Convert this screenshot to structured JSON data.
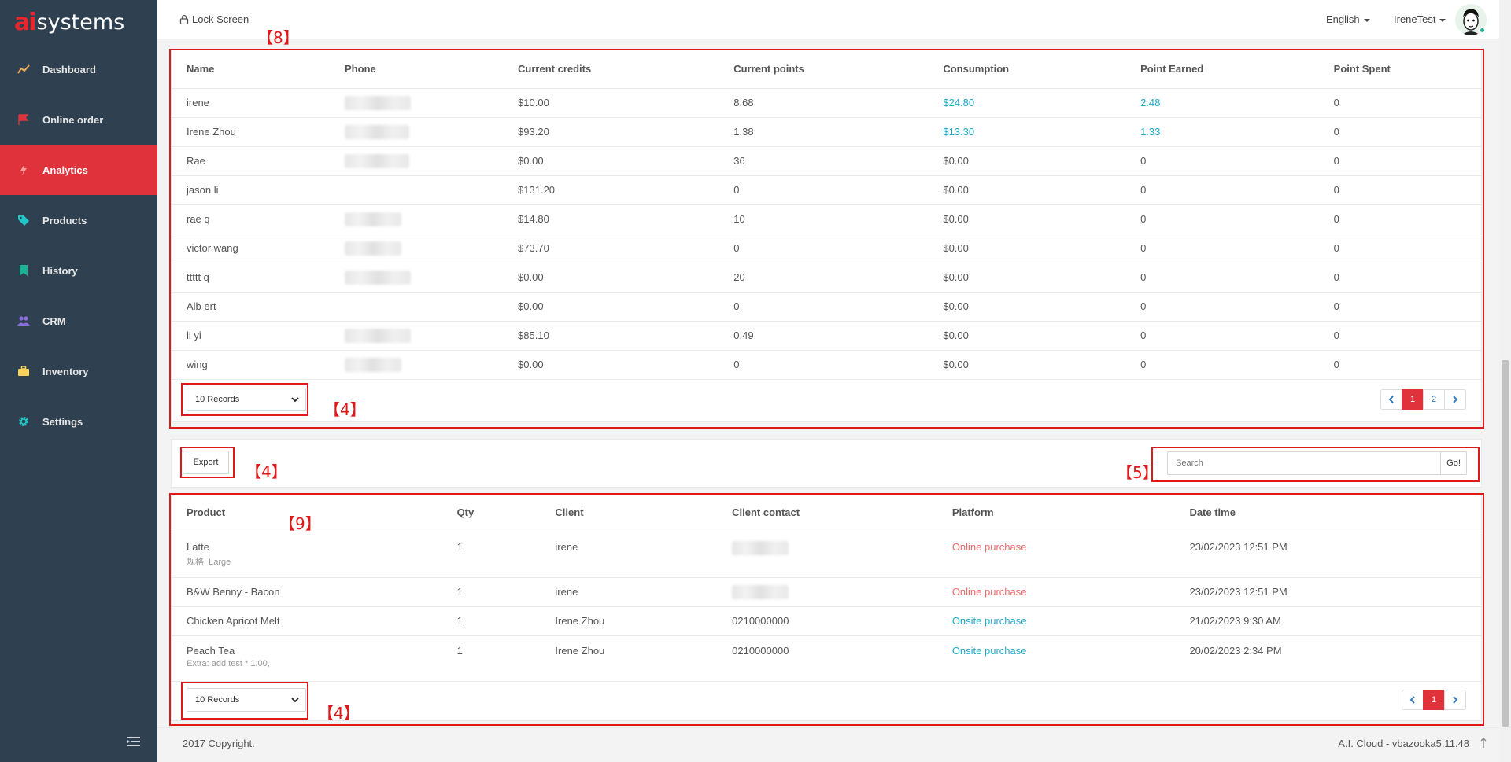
{
  "brand": {
    "logo_mark": "ai",
    "logo_text": "systems"
  },
  "sidebar": {
    "items": [
      {
        "label": "Dashboard",
        "icon": "line-chart-icon",
        "color": "#f8ac59",
        "active": false
      },
      {
        "label": "Online order",
        "icon": "flag-icon",
        "color": "#e0323a",
        "active": false
      },
      {
        "label": "Analytics",
        "icon": "bolt-icon",
        "color": "#f0a0a0",
        "active": true
      },
      {
        "label": "Products",
        "icon": "tags-icon",
        "color": "#23c6c8",
        "active": false
      },
      {
        "label": "History",
        "icon": "bookmark-icon",
        "color": "#1ab394",
        "active": false
      },
      {
        "label": "CRM",
        "icon": "users-icon",
        "color": "#8a6be0",
        "active": false
      },
      {
        "label": "Inventory",
        "icon": "briefcase-icon",
        "color": "#f8d359",
        "active": false
      },
      {
        "label": "Settings",
        "icon": "gear-icon",
        "color": "#23c6c8",
        "active": false
      }
    ]
  },
  "topbar": {
    "lock_label": "Lock Screen",
    "language": "English",
    "user": "IreneTest"
  },
  "customers": {
    "columns": [
      "Name",
      "Phone",
      "Current credits",
      "Current points",
      "Consumption",
      "Point Earned",
      "Point Spent"
    ],
    "rows": [
      {
        "name": "irene",
        "phone_blurred": true,
        "credits": "$10.00",
        "points": "8.68",
        "consumption": "$24.80",
        "earned": "2.48",
        "spent": "0",
        "highlight": true
      },
      {
        "name": "Irene Zhou",
        "phone_blurred": true,
        "credits": "$93.20",
        "points": "1.38",
        "consumption": "$13.30",
        "earned": "1.33",
        "spent": "0",
        "highlight": true
      },
      {
        "name": "Rae",
        "phone_blurred": true,
        "credits": "$0.00",
        "points": "36",
        "consumption": "$0.00",
        "earned": "0",
        "spent": "0",
        "highlight": false
      },
      {
        "name": "jason li",
        "phone_blurred": false,
        "credits": "$131.20",
        "points": "0",
        "consumption": "$0.00",
        "earned": "0",
        "spent": "0",
        "highlight": false
      },
      {
        "name": "rae q",
        "phone_blurred": true,
        "credits": "$14.80",
        "points": "10",
        "consumption": "$0.00",
        "earned": "0",
        "spent": "0",
        "highlight": false
      },
      {
        "name": "victor wang",
        "phone_blurred": true,
        "credits": "$73.70",
        "points": "0",
        "consumption": "$0.00",
        "earned": "0",
        "spent": "0",
        "highlight": false
      },
      {
        "name": "ttttt q",
        "phone_blurred": true,
        "credits": "$0.00",
        "points": "20",
        "consumption": "$0.00",
        "earned": "0",
        "spent": "0",
        "highlight": false
      },
      {
        "name": "Alb ert",
        "phone_blurred": false,
        "credits": "$0.00",
        "points": "0",
        "consumption": "$0.00",
        "earned": "0",
        "spent": "0",
        "highlight": false
      },
      {
        "name": "li yi",
        "phone_blurred": true,
        "credits": "$85.10",
        "points": "0.49",
        "consumption": "$0.00",
        "earned": "0",
        "spent": "0",
        "highlight": false
      },
      {
        "name": "wing",
        "phone_blurred": true,
        "credits": "$0.00",
        "points": "0",
        "consumption": "$0.00",
        "earned": "0",
        "spent": "0",
        "highlight": false
      }
    ],
    "records_select": "10 Records",
    "pages": [
      "1",
      "2"
    ],
    "current_page": "1"
  },
  "toolbar": {
    "export_label": "Export",
    "search_placeholder": "Search",
    "go_label": "Go!"
  },
  "orders": {
    "columns": [
      "Product",
      "Qty",
      "Client",
      "Client contact",
      "Platform",
      "Date time"
    ],
    "rows": [
      {
        "product": "Latte",
        "note": "规格: Large",
        "qty": "1",
        "client": "irene",
        "contact": "",
        "contact_blurred": true,
        "platform": "Online purchase",
        "platform_type": "online",
        "datetime": "23/02/2023 12:51 PM"
      },
      {
        "product": "B&W Benny - Bacon",
        "note": "",
        "qty": "1",
        "client": "irene",
        "contact": "",
        "contact_blurred": true,
        "platform": "Online purchase",
        "platform_type": "online",
        "datetime": "23/02/2023 12:51 PM"
      },
      {
        "product": "Chicken Apricot Melt",
        "note": "",
        "qty": "1",
        "client": "Irene Zhou",
        "contact": "0210000000",
        "contact_blurred": false,
        "platform": "Onsite purchase",
        "platform_type": "onsite",
        "datetime": "21/02/2023 9:30 AM"
      },
      {
        "product": "Peach Tea",
        "note": "Extra: add test * 1.00,",
        "qty": "1",
        "client": "Irene Zhou",
        "contact": "0210000000",
        "contact_blurred": false,
        "platform": "Onsite purchase",
        "platform_type": "onsite",
        "datetime": "20/02/2023 2:34 PM"
      }
    ],
    "records_select": "10 Records",
    "pages": [
      "1"
    ],
    "current_page": "1"
  },
  "annotations": {
    "a8": "【8】",
    "a4_customers": "【4】",
    "a4_export": "【4】",
    "a5": "【5】",
    "a9": "【9】",
    "a4_orders": "【4】"
  },
  "footer": {
    "copyright": "2017 Copyright.",
    "version": "A.I. Cloud - vbazooka5.11.48"
  }
}
